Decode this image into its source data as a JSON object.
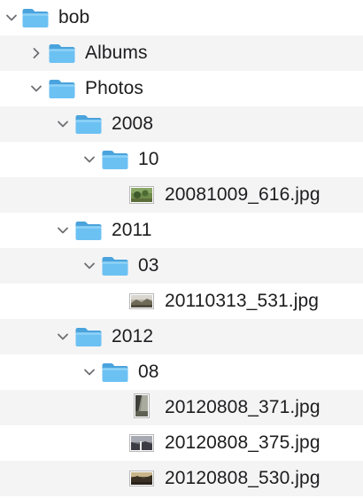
{
  "tree": {
    "items": [
      {
        "label": "bob",
        "type": "folder",
        "expanded": true,
        "icon": "folder-icon"
      },
      {
        "label": "Albums",
        "type": "folder",
        "expanded": false,
        "icon": "folder-icon"
      },
      {
        "label": "Photos",
        "type": "folder",
        "expanded": true,
        "icon": "folder-icon"
      },
      {
        "label": "2008",
        "type": "folder",
        "expanded": true,
        "icon": "folder-icon"
      },
      {
        "label": "10",
        "type": "folder",
        "expanded": true,
        "icon": "folder-icon"
      },
      {
        "label": "20081009_616.jpg",
        "type": "file",
        "icon": "image-thumbnail-icon"
      },
      {
        "label": "2011",
        "type": "folder",
        "expanded": true,
        "icon": "folder-icon"
      },
      {
        "label": "03",
        "type": "folder",
        "expanded": true,
        "icon": "folder-icon"
      },
      {
        "label": "20110313_531.jpg",
        "type": "file",
        "icon": "image-thumbnail-icon"
      },
      {
        "label": "2012",
        "type": "folder",
        "expanded": true,
        "icon": "folder-icon"
      },
      {
        "label": "08",
        "type": "folder",
        "expanded": true,
        "icon": "folder-icon"
      },
      {
        "label": "20120808_371.jpg",
        "type": "file",
        "icon": "image-thumbnail-icon"
      },
      {
        "label": "20120808_375.jpg",
        "type": "file",
        "icon": "image-thumbnail-icon"
      },
      {
        "label": "20120808_530.jpg",
        "type": "file",
        "icon": "image-thumbnail-icon"
      }
    ]
  },
  "colors": {
    "folder_body": "#5ab3ea",
    "folder_tab": "#4aa3dc",
    "folder_front": "#6cc1f3",
    "chevron": "#6e6e73",
    "stripe": "#f4f4f5"
  }
}
